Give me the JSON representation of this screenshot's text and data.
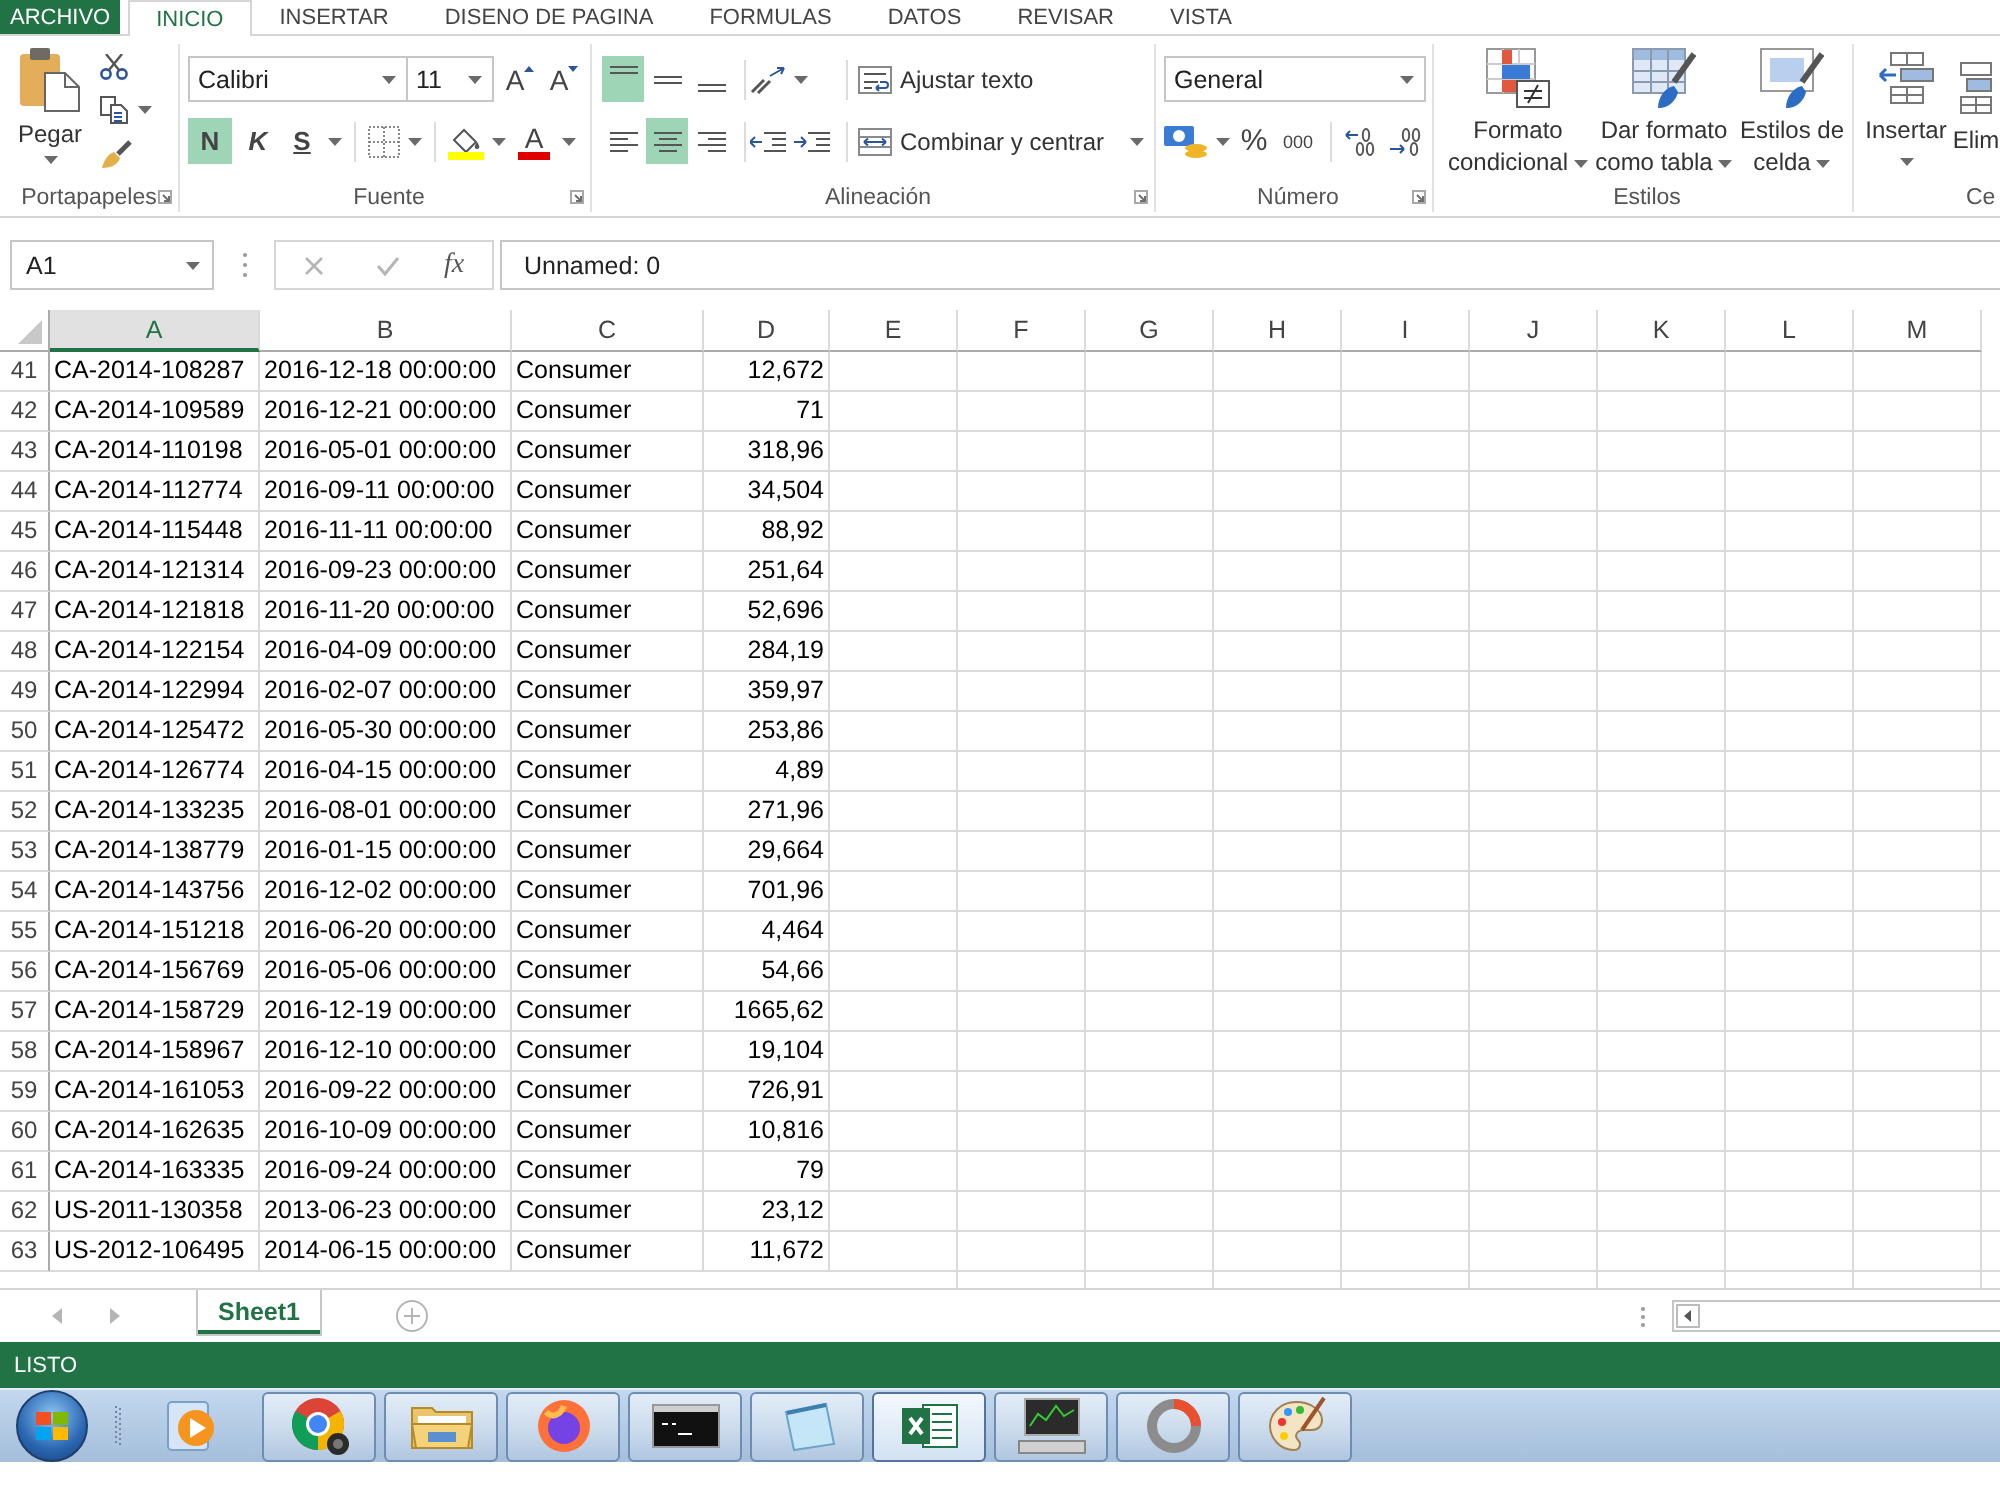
{
  "ribbon_tabs": [
    {
      "label": "ARCHIVO",
      "kind": "file",
      "selected": false
    },
    {
      "label": "INICIO",
      "kind": "tab",
      "selected": true
    },
    {
      "label": "INSERTAR",
      "kind": "tab",
      "selected": false
    },
    {
      "label": "DISENO DE PAGINA",
      "kind": "tab",
      "selected": false
    },
    {
      "label": "FORMULAS",
      "kind": "tab",
      "selected": false
    },
    {
      "label": "DATOS",
      "kind": "tab",
      "selected": false
    },
    {
      "label": "REVISAR",
      "kind": "tab",
      "selected": false
    },
    {
      "label": "VISTA",
      "kind": "tab",
      "selected": false
    }
  ],
  "ribbon": {
    "clipboard": {
      "paste_label": "Pegar",
      "group_label": "Portapapeles"
    },
    "font": {
      "font_name": "Calibri",
      "font_size": "11",
      "grow_label": "A",
      "shrink_label": "A",
      "bold": {
        "label": "N",
        "selected": true
      },
      "italic": {
        "label": "K",
        "selected": false
      },
      "underline": {
        "label": "S",
        "selected": false
      },
      "font_color_label": "A",
      "group_label": "Fuente"
    },
    "alignment": {
      "vertical": [
        {
          "kind": "top",
          "selected": true
        },
        {
          "kind": "middle",
          "selected": false
        },
        {
          "kind": "bottom",
          "selected": false
        }
      ],
      "horizontal": [
        {
          "kind": "left",
          "selected": false
        },
        {
          "kind": "center",
          "selected": true
        },
        {
          "kind": "right",
          "selected": false
        }
      ],
      "wrap_text_label": "Ajustar texto",
      "merge_label": "Combinar y centrar",
      "group_label": "Alineación"
    },
    "number": {
      "format": "General",
      "percent_label": "%",
      "thousands_label": "000",
      "group_label": "Número"
    },
    "styles": {
      "buttons": [
        {
          "kind": "conditional",
          "label": "Formato condicional"
        },
        {
          "kind": "table",
          "label": "Dar formato como tabla"
        },
        {
          "kind": "cell",
          "label": "Estilos de celda"
        }
      ],
      "group_label": "Estilos"
    },
    "cells": {
      "buttons": [
        {
          "kind": "insert",
          "label": "Insertar"
        },
        {
          "kind": "delete",
          "label": "Elim"
        }
      ],
      "group_label": "Ce"
    }
  },
  "formula_bar": {
    "name_box": "A1",
    "function_label": "fx",
    "value": "Unnamed: 0"
  },
  "sheet": {
    "columns": [
      {
        "label": "A",
        "selected": true
      },
      {
        "label": "B",
        "selected": false
      },
      {
        "label": "C",
        "selected": false
      },
      {
        "label": "D",
        "selected": false
      },
      {
        "label": "E",
        "selected": false
      },
      {
        "label": "F",
        "selected": false
      },
      {
        "label": "G",
        "selected": false
      },
      {
        "label": "H",
        "selected": false
      },
      {
        "label": "I",
        "selected": false
      },
      {
        "label": "J",
        "selected": false
      },
      {
        "label": "K",
        "selected": false
      },
      {
        "label": "L",
        "selected": false
      },
      {
        "label": "M",
        "selected": false
      }
    ],
    "rows": [
      {
        "number": "41",
        "cells": [
          "CA-2014-108287",
          "2016-12-18 00:00:00",
          "Consumer",
          "12,672"
        ]
      },
      {
        "number": "42",
        "cells": [
          "CA-2014-109589",
          "2016-12-21 00:00:00",
          "Consumer",
          "71"
        ]
      },
      {
        "number": "43",
        "cells": [
          "CA-2014-110198",
          "2016-05-01 00:00:00",
          "Consumer",
          "318,96"
        ]
      },
      {
        "number": "44",
        "cells": [
          "CA-2014-112774",
          "2016-09-11 00:00:00",
          "Consumer",
          "34,504"
        ]
      },
      {
        "number": "45",
        "cells": [
          "CA-2014-115448",
          "2016-11-11 00:00:00",
          "Consumer",
          "88,92"
        ]
      },
      {
        "number": "46",
        "cells": [
          "CA-2014-121314",
          "2016-09-23 00:00:00",
          "Consumer",
          "251,64"
        ]
      },
      {
        "number": "47",
        "cells": [
          "CA-2014-121818",
          "2016-11-20 00:00:00",
          "Consumer",
          "52,696"
        ]
      },
      {
        "number": "48",
        "cells": [
          "CA-2014-122154",
          "2016-04-09 00:00:00",
          "Consumer",
          "284,19"
        ]
      },
      {
        "number": "49",
        "cells": [
          "CA-2014-122994",
          "2016-02-07 00:00:00",
          "Consumer",
          "359,97"
        ]
      },
      {
        "number": "50",
        "cells": [
          "CA-2014-125472",
          "2016-05-30 00:00:00",
          "Consumer",
          "253,86"
        ]
      },
      {
        "number": "51",
        "cells": [
          "CA-2014-126774",
          "2016-04-15 00:00:00",
          "Consumer",
          "4,89"
        ]
      },
      {
        "number": "52",
        "cells": [
          "CA-2014-133235",
          "2016-08-01 00:00:00",
          "Consumer",
          "271,96"
        ]
      },
      {
        "number": "53",
        "cells": [
          "CA-2014-138779",
          "2016-01-15 00:00:00",
          "Consumer",
          "29,664"
        ]
      },
      {
        "number": "54",
        "cells": [
          "CA-2014-143756",
          "2016-12-02 00:00:00",
          "Consumer",
          "701,96"
        ]
      },
      {
        "number": "55",
        "cells": [
          "CA-2014-151218",
          "2016-06-20 00:00:00",
          "Consumer",
          "4,464"
        ]
      },
      {
        "number": "56",
        "cells": [
          "CA-2014-156769",
          "2016-05-06 00:00:00",
          "Consumer",
          "54,66"
        ]
      },
      {
        "number": "57",
        "cells": [
          "CA-2014-158729",
          "2016-12-19 00:00:00",
          "Consumer",
          "1665,62"
        ]
      },
      {
        "number": "58",
        "cells": [
          "CA-2014-158967",
          "2016-12-10 00:00:00",
          "Consumer",
          "19,104"
        ]
      },
      {
        "number": "59",
        "cells": [
          "CA-2014-161053",
          "2016-09-22 00:00:00",
          "Consumer",
          "726,91"
        ]
      },
      {
        "number": "60",
        "cells": [
          "CA-2014-162635",
          "2016-10-09 00:00:00",
          "Consumer",
          "10,816"
        ]
      },
      {
        "number": "61",
        "cells": [
          "CA-2014-163335",
          "2016-09-24 00:00:00",
          "Consumer",
          "79"
        ]
      },
      {
        "number": "62",
        "cells": [
          "US-2011-130358",
          "2013-06-23 00:00:00",
          "Consumer",
          "23,12"
        ]
      },
      {
        "number": "63",
        "cells": [
          "US-2012-106495",
          "2014-06-15 00:00:00",
          "Consumer",
          "11,672"
        ]
      }
    ]
  },
  "sheet_tabs": [
    {
      "label": "Sheet1",
      "selected": true
    }
  ],
  "status_bar": {
    "text": "LISTO"
  },
  "taskbar": {
    "quick_launch": [
      {
        "kind": "media"
      }
    ],
    "buttons": [
      {
        "kind": "browser",
        "selected": false
      },
      {
        "kind": "folder",
        "selected": false
      },
      {
        "kind": "fox",
        "selected": false
      },
      {
        "kind": "terminal",
        "selected": false
      },
      {
        "kind": "notepad",
        "selected": false
      },
      {
        "kind": "spreadsheet",
        "selected": true
      },
      {
        "kind": "monitor",
        "selected": false
      },
      {
        "kind": "ring",
        "selected": false
      },
      {
        "kind": "palette",
        "selected": false
      }
    ]
  }
}
